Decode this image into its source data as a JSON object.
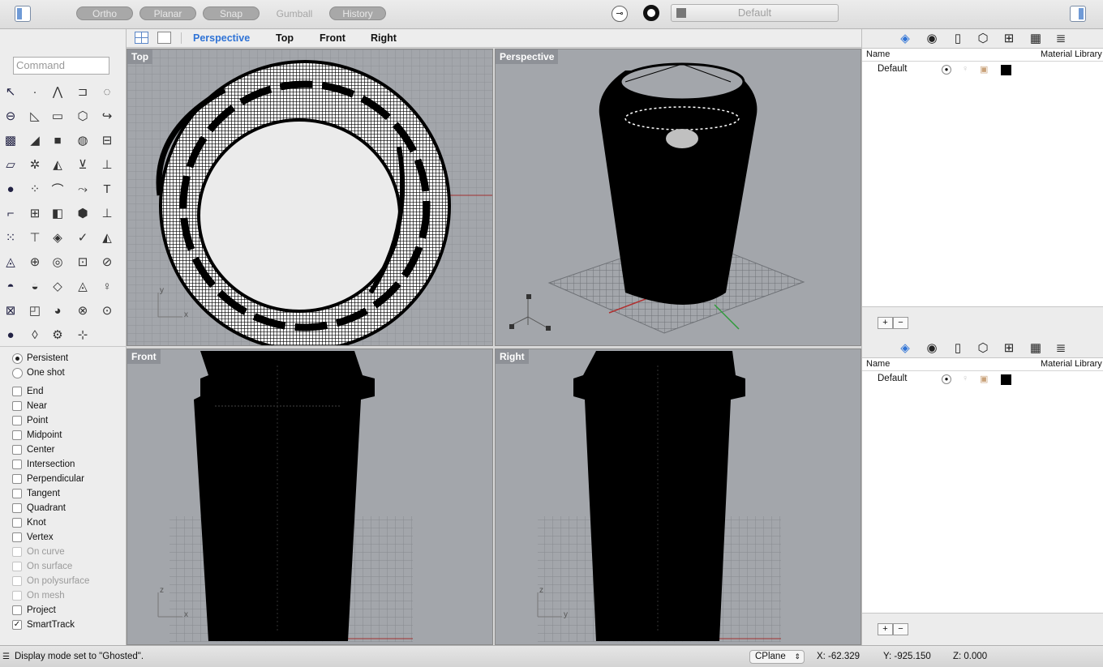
{
  "toolbar": {
    "ortho": "Ortho",
    "planar": "Planar",
    "snap": "Snap",
    "gumball": "Gumball",
    "history": "History",
    "layer_name": "Default"
  },
  "view_tabs": [
    "Perspective",
    "Top",
    "Front",
    "Right"
  ],
  "command": {
    "placeholder": "Command"
  },
  "osnap": {
    "persistent": "Persistent",
    "one_shot": "One shot",
    "items": [
      {
        "label": "End",
        "checked": false,
        "enabled": true
      },
      {
        "label": "Near",
        "checked": false,
        "enabled": true
      },
      {
        "label": "Point",
        "checked": false,
        "enabled": true
      },
      {
        "label": "Midpoint",
        "checked": false,
        "enabled": true
      },
      {
        "label": "Center",
        "checked": false,
        "enabled": true
      },
      {
        "label": "Intersection",
        "checked": false,
        "enabled": true
      },
      {
        "label": "Perpendicular",
        "checked": false,
        "enabled": true
      },
      {
        "label": "Tangent",
        "checked": false,
        "enabled": true
      },
      {
        "label": "Quadrant",
        "checked": false,
        "enabled": true
      },
      {
        "label": "Knot",
        "checked": false,
        "enabled": true
      },
      {
        "label": "Vertex",
        "checked": false,
        "enabled": true
      },
      {
        "label": "On curve",
        "checked": false,
        "enabled": false
      },
      {
        "label": "On surface",
        "checked": false,
        "enabled": false
      },
      {
        "label": "On polysurface",
        "checked": false,
        "enabled": false
      },
      {
        "label": "On mesh",
        "checked": false,
        "enabled": false
      },
      {
        "label": "Project",
        "checked": false,
        "enabled": true
      },
      {
        "label": "SmartTrack",
        "checked": true,
        "enabled": true
      }
    ]
  },
  "viewports": {
    "top": "Top",
    "perspective": "Perspective",
    "front": "Front",
    "right": "Right",
    "axis_x": "x",
    "axis_y": "y",
    "axis_z": "z"
  },
  "layers_panel": {
    "col_name": "Name",
    "col_material": "Material Library",
    "rows": [
      {
        "name": "Default"
      }
    ],
    "add": "+",
    "remove": "−"
  },
  "status": {
    "message": "Display mode set to \"Ghosted\".",
    "cplane": "CPlane",
    "x": "X: -62.329",
    "y": "Y: -925.150",
    "z": "Z: 0.000"
  },
  "colors": {
    "accent": "#2f73d6",
    "viewport_bg": "#a3a6ab",
    "x_axis": "#b03030",
    "y_axis": "#2f9a3a"
  },
  "icons": [
    "sidebar-toggle-icon",
    "target-icon",
    "ring-icon",
    "grid-icon",
    "layers-icon",
    "material-icon",
    "page-icon",
    "cube-icon",
    "panels-icon",
    "render-icon",
    "notes-icon"
  ]
}
